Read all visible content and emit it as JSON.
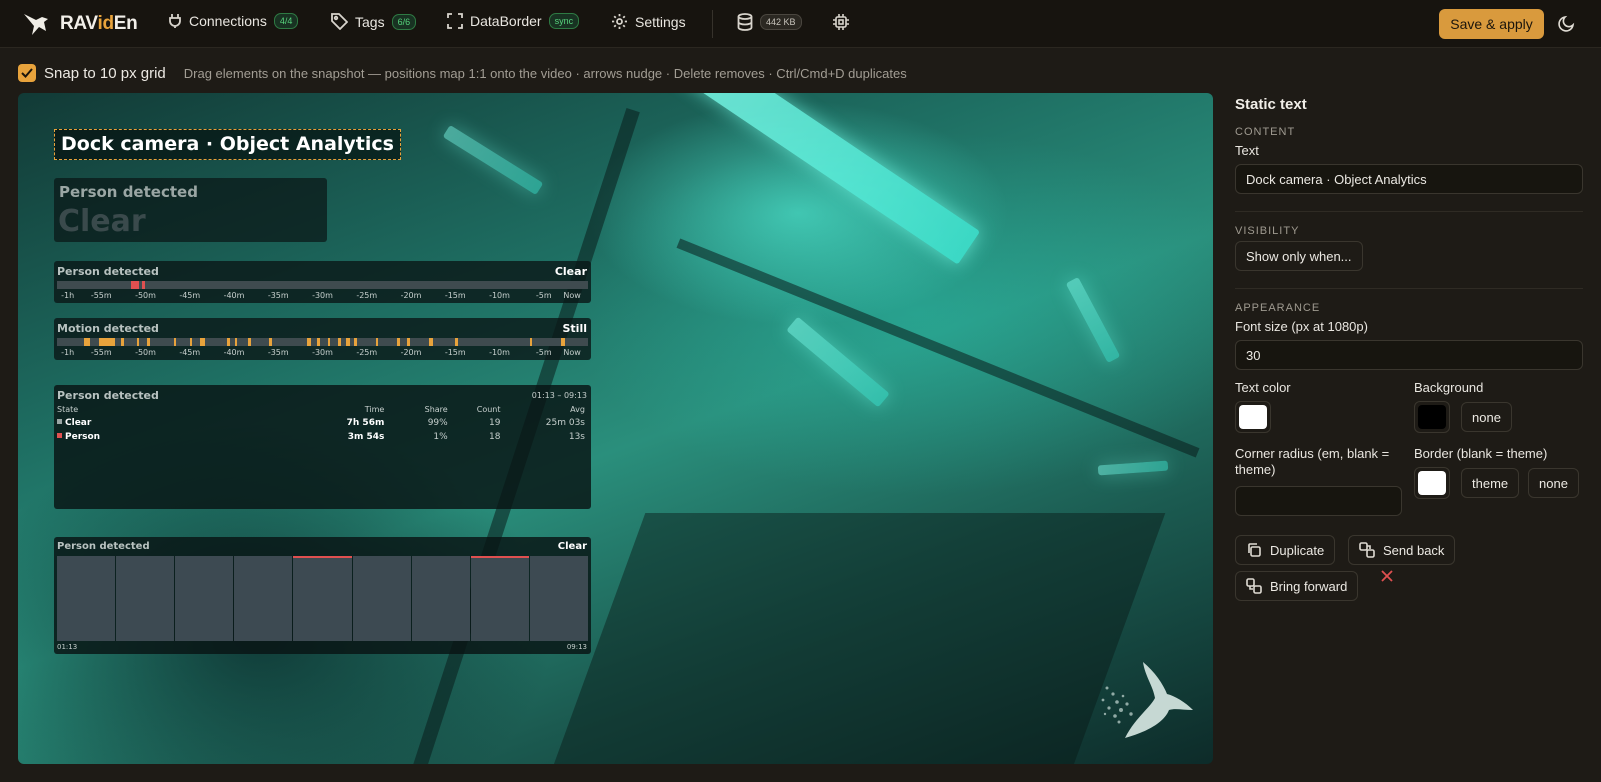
{
  "app": {
    "brand_pre": "RAV",
    "brand_accent": "id",
    "brand_post": "En"
  },
  "nav": {
    "connections": {
      "label": "Connections",
      "badge": "4/4"
    },
    "tags": {
      "label": "Tags",
      "badge": "6/6"
    },
    "databorder": {
      "label": "DataBorder",
      "badge": "sync"
    },
    "settings": {
      "label": "Settings"
    },
    "storage": {
      "badge": "442 KB"
    }
  },
  "toolbar": {
    "save_label": "Save & apply"
  },
  "snap": {
    "label": "Snap to 10 px grid",
    "checked": true,
    "hint": "Drag elements on the snapshot — positions map 1:1 onto the video · arrows nudge · Delete removes · Ctrl/Cmd+D duplicates"
  },
  "overlay": {
    "title": "Dock camera · Object Analytics",
    "state_widget": {
      "label": "Person detected",
      "value": "Clear"
    },
    "timeline_person": {
      "label": "Person detected",
      "value": "Clear",
      "ticks": [
        "-1h",
        "-55m",
        "-50m",
        "-45m",
        "-40m",
        "-35m",
        "-30m",
        "-25m",
        "-20m",
        "-15m",
        "-10m",
        "-5m",
        "Now"
      ]
    },
    "timeline_motion": {
      "label": "Motion detected",
      "value": "Still",
      "ticks": [
        "-1h",
        "-55m",
        "-50m",
        "-45m",
        "-40m",
        "-35m",
        "-30m",
        "-25m",
        "-20m",
        "-15m",
        "-10m",
        "-5m",
        "Now"
      ]
    },
    "stats": {
      "label": "Person detected",
      "range": "01:13 – 09:13",
      "headers": [
        "State",
        "Time",
        "Share",
        "Count",
        "Avg"
      ],
      "rows": [
        {
          "state": "Clear",
          "time": "7h 56m",
          "share": "99%",
          "count": "19",
          "avg": "25m 03s",
          "color": "#9aa6a4"
        },
        {
          "state": "Person",
          "time": "3m 54s",
          "share": "1%",
          "count": "18",
          "avg": "13s",
          "color": "#e05050"
        }
      ]
    },
    "columns": {
      "label": "Person detected",
      "value": "Clear",
      "x_start": "01:13",
      "x_end": "09:13"
    }
  },
  "panel": {
    "title": "Static text",
    "content_section": "CONTENT",
    "text_label": "Text",
    "text_value": "Dock camera · Object Analytics",
    "visibility_section": "VISIBILITY",
    "visibility_button": "Show only when...",
    "appearance_section": "APPEARANCE",
    "font_size_label": "Font size (px at 1080p)",
    "font_size_value": "30",
    "text_color_label": "Text color",
    "background_label": "Background",
    "background_none": "none",
    "corner_label": "Corner radius (em, blank = theme)",
    "corner_value": "",
    "border_label": "Border (blank = theme)",
    "border_theme": "theme",
    "border_none": "none",
    "duplicate": "Duplicate",
    "send_back": "Send back",
    "bring_forward": "Bring forward",
    "text_color": "#ffffff",
    "background_color": "#000000",
    "border_color": "#ffffff"
  },
  "colors": {
    "accent": "#e8a33c",
    "success": "#57d27c",
    "danger": "#e05050"
  }
}
